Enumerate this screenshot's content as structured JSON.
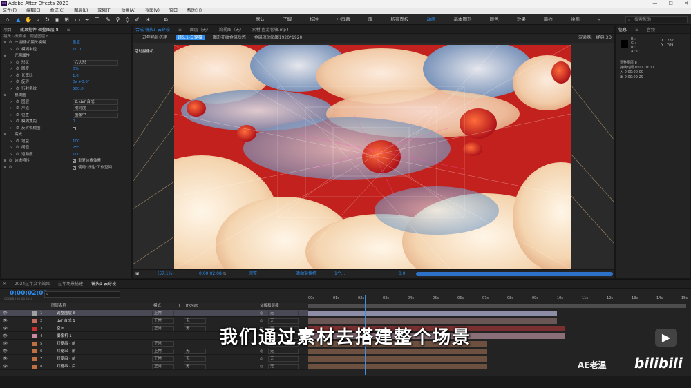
{
  "app": {
    "title": "Adobe After Effects 2020",
    "logo_text": "Ae",
    "window_buttons": [
      "—",
      "☐",
      "✕"
    ]
  },
  "menu": [
    "文件(F)",
    "编辑(E)",
    "合成(C)",
    "图层(L)",
    "效果(T)",
    "动画(A)",
    "视图(V)",
    "窗口",
    "帮助(H)"
  ],
  "workspaces": {
    "items": [
      "默认",
      "了解",
      "标准",
      "小屏幕",
      "库",
      "所有面板",
      "动画",
      "基本图形",
      "颜色",
      "效果",
      "简约",
      "绘画"
    ],
    "active": "动画",
    "more": "»",
    "search_placeholder": "搜索帮助"
  },
  "left_panel": {
    "tabs": [
      "项目",
      "效果控件 调整图层 8",
      "≡"
    ],
    "breadcrumb": "镜头1-云穿梭 · 调整图层 8",
    "rows": [
      {
        "indent": 0,
        "label": "fx 摄像机镜头模糊",
        "value": "重置",
        "kind": "value"
      },
      {
        "indent": 1,
        "label": "模糊半径",
        "value": "10.0",
        "kind": "value"
      },
      {
        "indent": 0,
        "label": "光圈属性",
        "value": "",
        "kind": "group"
      },
      {
        "indent": 1,
        "label": "形状",
        "value": "六边形",
        "kind": "dropdown"
      },
      {
        "indent": 1,
        "label": "圆度",
        "value": "0%",
        "kind": "value"
      },
      {
        "indent": 1,
        "label": "长宽比",
        "value": "1.0",
        "kind": "value"
      },
      {
        "indent": 1,
        "label": "旋转",
        "value": "0x +0.0°",
        "kind": "value"
      },
      {
        "indent": 1,
        "label": "衍射条纹",
        "value": "500.0",
        "kind": "value"
      },
      {
        "indent": 0,
        "label": "模糊图",
        "value": "",
        "kind": "group"
      },
      {
        "indent": 1,
        "label": "图层",
        "value": "2. daf 合成",
        "kind": "dropdown"
      },
      {
        "indent": 1,
        "label": "声道",
        "value": "明亮度",
        "kind": "dropdown"
      },
      {
        "indent": 1,
        "label": "位置",
        "value": "图像中",
        "kind": "dropdown"
      },
      {
        "indent": 1,
        "label": "模糊焦距",
        "value": "0",
        "kind": "value"
      },
      {
        "indent": 1,
        "label": "反转模糊图",
        "value": "",
        "kind": "checkbox",
        "checked": false
      },
      {
        "indent": 0,
        "label": "高光",
        "value": "",
        "kind": "group"
      },
      {
        "indent": 1,
        "label": "增益",
        "value": "100",
        "kind": "value"
      },
      {
        "indent": 1,
        "label": "阈值",
        "value": "255",
        "kind": "value"
      },
      {
        "indent": 1,
        "label": "饱和度",
        "value": "100",
        "kind": "value"
      },
      {
        "indent": 0,
        "label": "边缘特性",
        "value": "",
        "kind": "checkbox",
        "checked": true,
        "check_label": "重复边缘像素"
      },
      {
        "indent": 0,
        "label": "",
        "value": "",
        "kind": "checkbox",
        "checked": true,
        "check_label": "使用\"线性\"工作空间"
      }
    ],
    "layer_dropdown_extra": "源"
  },
  "viewer": {
    "tabs": [
      "合成 镜头1-云穿梭",
      "≡",
      "图层（无）",
      "流视图（无）",
      "素材 盘龙卷轴.mp4"
    ],
    "subtabs": [
      "过年场景搭建",
      "镜头1-云穿梭",
      "图形花纹金属质感",
      "金属流动贴图1920*1920"
    ],
    "renderer_label": "渲染器:",
    "renderer_value": "经典 3D",
    "camera_label": "活动摄像机",
    "bottom": {
      "zoom": "(57.1%)",
      "timecode": "0:00:02:08",
      "quality": "完整",
      "camera": "活动摄像机",
      "views": "1个...",
      "exposure": "+0.0"
    }
  },
  "info_panel": {
    "tabs": [
      "信息",
      "≡",
      "音频"
    ],
    "rgb": [
      "R :",
      "G :",
      "B :",
      "A : 0"
    ],
    "xy": [
      "X : 282",
      "Y : 709"
    ],
    "layer": "调整图层 8",
    "duration_label": "持续时间",
    "duration": "0:00:10:00",
    "in_label": "入",
    "in_point": "0:00:00:00",
    "out_label": "出",
    "out_point": "0:00:09:29"
  },
  "timeline": {
    "tabs": [
      "2024过年文字效果",
      "过年场景搭建",
      "镜头1-云穿梭"
    ],
    "active_tab": "镜头1-云穿梭",
    "timecode": "0:00:02:08",
    "timecode_sub": "00068 (30.00 fps)",
    "search_placeholder": "",
    "columns": [
      "图层名称",
      "模式",
      "T",
      "TrkMat",
      "父级和链接"
    ],
    "ruler": [
      "00s",
      "01s",
      "02s",
      "03s",
      "04s",
      "05s",
      "06s",
      "07s",
      "08s",
      "09s",
      "10s",
      "11s",
      "12s",
      "13s",
      "14s",
      "15s"
    ],
    "playhead": {
      "seconds": 2.27
    },
    "layers": [
      {
        "num": "1",
        "name": "调整图层 8",
        "color": "#a0a0a0",
        "mode": "正常",
        "trkmat": "",
        "parent": "无",
        "selected": true,
        "bar": {
          "start": 0,
          "end": 10,
          "color": "#8d8da8"
        }
      },
      {
        "num": "2",
        "name": "daf 合成 1",
        "color": "#c46b5d",
        "mode": "正常",
        "trkmat": "无",
        "parent": "无",
        "selected": false,
        "bar": {
          "start": 0,
          "end": 10,
          "color": "#6b5656"
        }
      },
      {
        "num": "3",
        "name": "空 6",
        "color": "#c43030",
        "mode": "正常",
        "trkmat": "无",
        "parent": "无",
        "selected": false,
        "bar": {
          "start": 0,
          "end": 10.3,
          "color": "#7a3030"
        }
      },
      {
        "num": "4",
        "name": "摄像机 1",
        "color": "#c88aa0",
        "mode": "",
        "trkmat": "",
        "parent": "无",
        "selected": false,
        "bar": {
          "start": 0,
          "end": 10.3,
          "color": "#8a6e78"
        }
      },
      {
        "num": "5",
        "name": "灯笼串 - 前",
        "color": "#c07040",
        "mode": "正常",
        "trkmat": "",
        "parent": "无",
        "selected": false,
        "bar": {
          "start": 0,
          "end": 7.2,
          "color": "#6e5040"
        }
      },
      {
        "num": "6",
        "name": "灯笼串 - 前",
        "color": "#c07040",
        "mode": "正常",
        "trkmat": "无",
        "parent": "无",
        "selected": false,
        "bar": {
          "start": 0,
          "end": 7.2,
          "color": "#6e5040"
        }
      },
      {
        "num": "7",
        "name": "灯笼串 - 前",
        "color": "#c07040",
        "mode": "正常",
        "trkmat": "无",
        "parent": "无",
        "selected": false,
        "bar": {
          "start": 0,
          "end": 7.2,
          "color": "#6e5040"
        }
      },
      {
        "num": "8",
        "name": "灯笼串 - 后",
        "color": "#c07040",
        "mode": "正常",
        "trkmat": "无",
        "parent": "无",
        "selected": false,
        "bar": {
          "start": 0,
          "end": 7.2,
          "color": "#6e5040"
        }
      }
    ]
  },
  "subtitle": "我们通过素材去搭建整个场景",
  "watermark": {
    "left": "AE老温",
    "right": "bilibili"
  },
  "colors": {
    "accent": "#2d8ceb",
    "panel": "#232323",
    "dark": "#1d1d1d",
    "viewer_bg": "#c0201c",
    "playhead": "#3b8fe6"
  }
}
